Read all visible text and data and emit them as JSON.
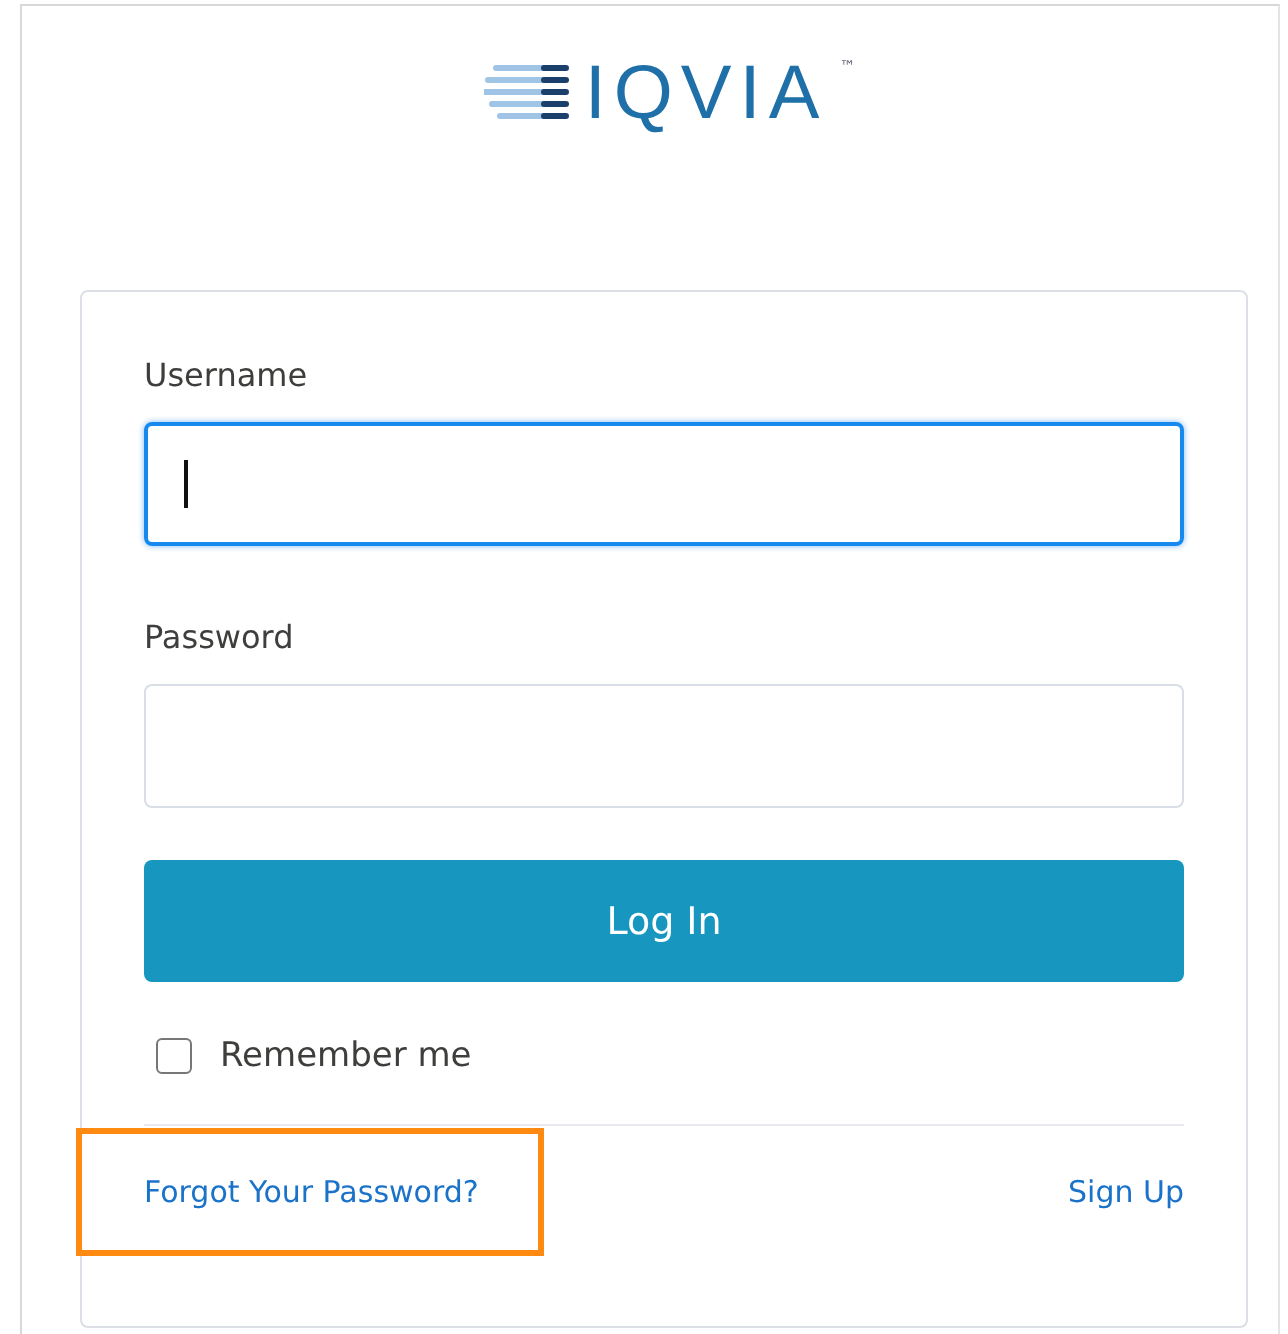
{
  "logo": {
    "text": "IQVIA",
    "trademark": "™"
  },
  "username": {
    "label": "Username",
    "focused": true
  },
  "password": {
    "label": "Password",
    "focused": false
  },
  "login_button": {
    "label": "Log In"
  },
  "remember_me": {
    "label": "Remember me",
    "checked": false
  },
  "links": [
    {
      "label": "Forgot Your Password?",
      "highlighted": true
    },
    {
      "label": "Sign Up",
      "highlighted": false
    }
  ]
}
